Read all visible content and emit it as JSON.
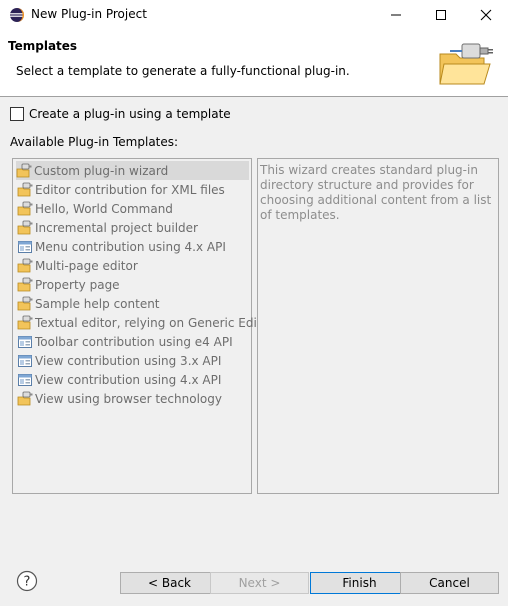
{
  "window": {
    "title": "New Plug-in Project",
    "minimize_icon": "minimize-icon",
    "maximize_icon": "maximize-icon",
    "close_icon": "close-icon"
  },
  "header": {
    "title": "Templates",
    "description": "Select a template to generate a fully-functional plug-in.",
    "image": "plugin-wizard-banner-icon"
  },
  "checkbox": {
    "label": "Create a plug-in using a template",
    "checked": false
  },
  "templates": {
    "label": "Available Plug-in Templates:",
    "items": [
      {
        "label": "Custom plug-in wizard",
        "icon": "plugin-template-icon",
        "selected": true
      },
      {
        "label": "Editor contribution for XML files",
        "icon": "plugin-template-icon"
      },
      {
        "label": "Hello, World Command",
        "icon": "plugin-template-icon"
      },
      {
        "label": "Incremental project builder",
        "icon": "plugin-template-icon"
      },
      {
        "label": "Menu contribution using 4.x API",
        "icon": "e4-template-icon"
      },
      {
        "label": "Multi-page editor",
        "icon": "plugin-template-icon"
      },
      {
        "label": "Property page",
        "icon": "plugin-template-icon"
      },
      {
        "label": "Sample help content",
        "icon": "plugin-template-icon"
      },
      {
        "label": "Textual editor, relying on Generic Editor",
        "icon": "plugin-template-icon"
      },
      {
        "label": "Toolbar contribution using e4 API",
        "icon": "e4-template-icon"
      },
      {
        "label": "View contribution using 3.x API",
        "icon": "e4-template-icon"
      },
      {
        "label": "View contribution using 4.x API",
        "icon": "e4-template-icon"
      },
      {
        "label": "View using browser technology",
        "icon": "plugin-template-icon"
      }
    ],
    "description": "This wizard creates standard plug-in directory structure and provides for choosing additional content from a list of templates."
  },
  "buttons": {
    "back": "< Back",
    "next": "Next >",
    "finish": "Finish",
    "cancel": "Cancel",
    "help_icon": "help-icon"
  }
}
